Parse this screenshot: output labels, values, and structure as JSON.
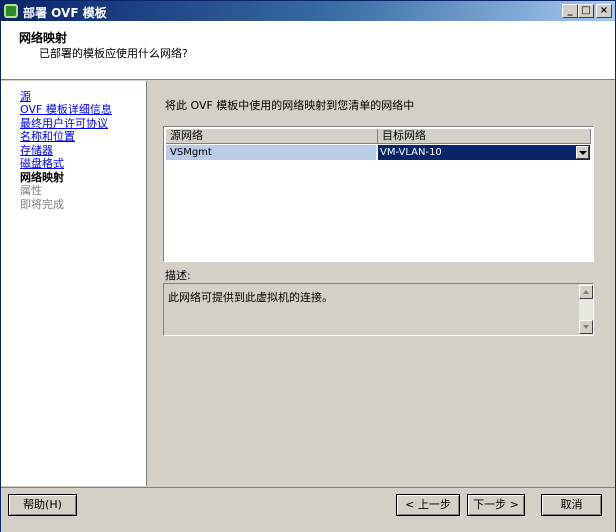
{
  "window": {
    "title": "部署 OVF 模板",
    "controls": {
      "minimize": "_",
      "maximize": "□",
      "close": "×"
    }
  },
  "header": {
    "title": "网络映射",
    "subtitle": "已部署的模板应使用什么网络?"
  },
  "sidebar": {
    "steps": [
      {
        "label": "源",
        "state": "link"
      },
      {
        "label": "OVF 模板详细信息",
        "state": "link"
      },
      {
        "label": "最终用户许可协议",
        "state": "link"
      },
      {
        "label": "名称和位置",
        "state": "link"
      },
      {
        "label": "存储器",
        "state": "link"
      },
      {
        "label": "磁盘格式",
        "state": "link"
      },
      {
        "label": "网络映射",
        "state": "current"
      },
      {
        "label": "属性",
        "state": "disabled"
      },
      {
        "label": "即将完成",
        "state": "disabled"
      }
    ]
  },
  "main": {
    "instruction": "将此 OVF 模板中使用的网络映射到您清单的网络中",
    "table": {
      "columns": [
        "源网络",
        "目标网络"
      ],
      "rows": [
        {
          "source": "VSMgmt",
          "destination": "VM-VLAN-10"
        }
      ]
    },
    "description_label": "描述:",
    "description_text": "此网络可提供到此虚拟机的连接。"
  },
  "footer": {
    "help": "帮助(H)",
    "back": "< 上一步",
    "next": "下一步 >",
    "cancel": "取消"
  },
  "colors": {
    "title_bar": "#0a246a",
    "selected_cell": "#0a246a",
    "source_cell": "#b9cbe6",
    "link": "#0000ff",
    "disabled": "#808080",
    "dialog_bg": "#d4d0c8"
  },
  "icons": [
    "app-icon",
    "dropdown-arrow-icon",
    "scroll-up-icon",
    "scroll-down-icon"
  ]
}
